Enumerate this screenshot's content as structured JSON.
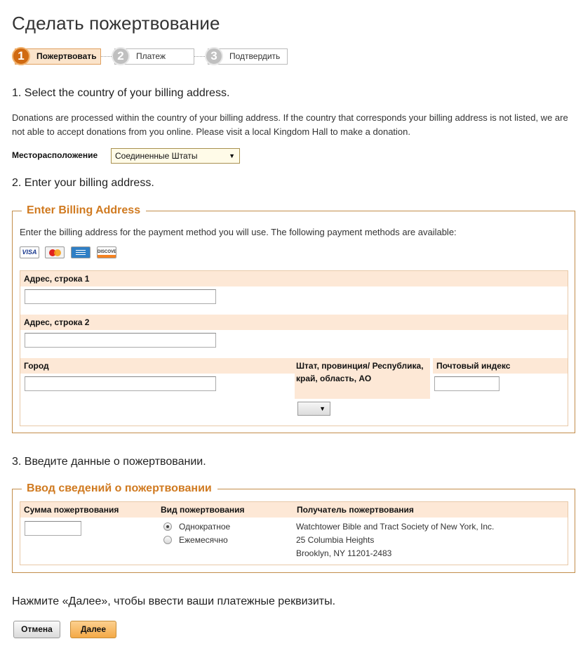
{
  "page_title": "Сделать пожертвование",
  "steps": [
    {
      "number": "1",
      "label": "Пожертвовать",
      "active": true
    },
    {
      "number": "2",
      "label": "Платеж",
      "active": false
    },
    {
      "number": "3",
      "label": "Подтвердить",
      "active": false
    }
  ],
  "section1": {
    "heading": "1. Select the country of your billing address.",
    "info": "Donations are processed within the country of your billing address. If the country that corresponds your billing address is not listed, we are not able to accept donations from you online. Please visit a local Kingdom Hall to make a donation.",
    "location_label": "Месторасположение",
    "location_value": "Соединенные Штаты"
  },
  "section2": {
    "heading": "2. Enter your billing address.",
    "legend": "Enter Billing Address",
    "intro": "Enter the billing address for the payment method you will use. The following payment methods are available:",
    "cards": [
      "visa-card-icon",
      "mastercard-card-icon",
      "amex-card-icon",
      "discover-card-icon"
    ],
    "card_visa_text": "VISA",
    "card_discover_text": "DISCOVER",
    "address1_label": "Адрес, строка 1",
    "address1_value": "",
    "address2_label": "Адрес, строка 2",
    "address2_value": "",
    "city_label": "Город",
    "city_value": "",
    "state_label": "Штат, провинция/ Республика, край, область, АО",
    "state_value": "",
    "zip_label": "Почтовый индекс",
    "zip_value": ""
  },
  "section3": {
    "heading": "3. Введите данные о пожертвовании.",
    "legend": "Ввод сведений о пожертвовании",
    "amount_label": "Сумма пожертвования",
    "amount_value": "",
    "type_label": "Вид пожертвования",
    "type_options": [
      {
        "label": "Однократное",
        "checked": true
      },
      {
        "label": "Ежемесячно",
        "checked": false
      }
    ],
    "recipient_label": "Получатель пожертвования",
    "recipient_lines": [
      "Watchtower Bible and Tract Society of New York, Inc.",
      "25 Columbia Heights",
      "Brooklyn, NY 11201-2483"
    ]
  },
  "next_prompt": "Нажмите «Далее», чтобы ввести ваши платежные реквизиты.",
  "buttons": {
    "cancel": "Отмена",
    "next": "Далее"
  },
  "colors": {
    "accent_orange": "#d07a20",
    "header_row_bg": "#fde8d6",
    "next_button": "#f4a946"
  }
}
